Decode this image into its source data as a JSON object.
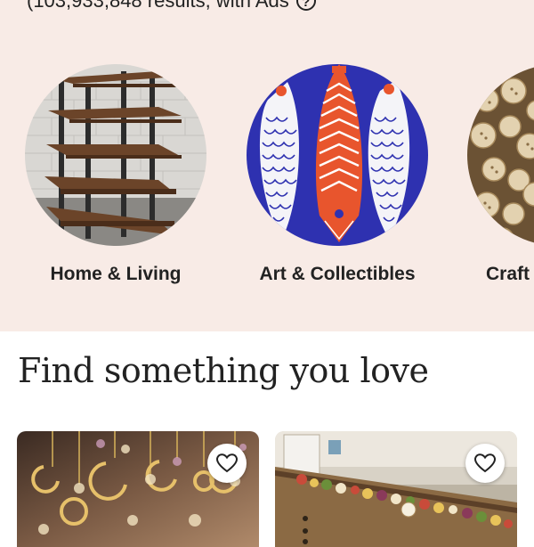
{
  "header": {
    "results_text": "(103,933,848 results, with Ads",
    "info_icon": "?"
  },
  "categories": [
    {
      "label": "Home & Living",
      "icon": "shelf-image"
    },
    {
      "label": "Art & Collectibles",
      "icon": "fish-art-image"
    },
    {
      "label": "Craft",
      "icon": "buttons-image"
    }
  ],
  "section": {
    "title": "Find something you love"
  },
  "colors": {
    "top_band": "#f8ebe6",
    "art_blue": "#2e31b0",
    "art_orange": "#e8552d"
  }
}
